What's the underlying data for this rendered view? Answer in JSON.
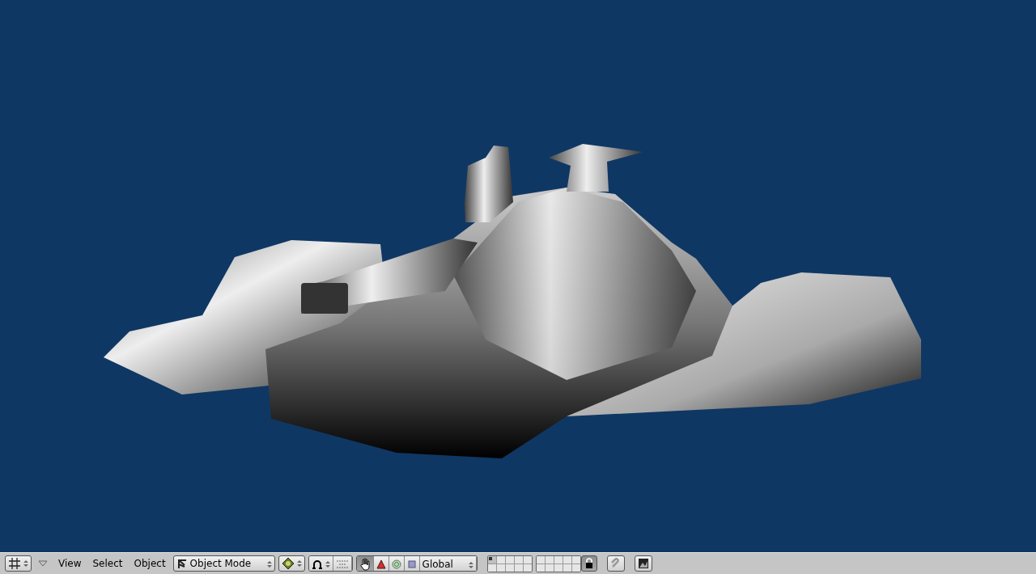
{
  "menu": [
    {
      "label": "View"
    },
    {
      "label": "Select"
    },
    {
      "label": "Object"
    }
  ],
  "mode_dropdown": {
    "value": "Object Mode"
  },
  "manipulator_toggle": {
    "on": true
  },
  "manipulators": [
    {
      "kind": "translate",
      "selected": false
    },
    {
      "kind": "rotate",
      "selected": false
    },
    {
      "kind": "scale",
      "selected": false
    }
  ],
  "orientation_dropdown": {
    "value": "Global"
  },
  "layers": [
    {
      "selected": true
    },
    {
      "selected": false
    },
    {
      "selected": false
    },
    {
      "selected": false
    },
    {
      "selected": false
    },
    {
      "selected": false
    },
    {
      "selected": false
    },
    {
      "selected": false
    },
    {
      "selected": false
    },
    {
      "selected": false
    },
    {
      "selected": false
    },
    {
      "selected": false
    },
    {
      "selected": false
    },
    {
      "selected": false
    },
    {
      "selected": false
    },
    {
      "selected": false
    },
    {
      "selected": false
    },
    {
      "selected": false
    },
    {
      "selected": false
    },
    {
      "selected": false
    }
  ],
  "layer_lock": {
    "on": true
  }
}
